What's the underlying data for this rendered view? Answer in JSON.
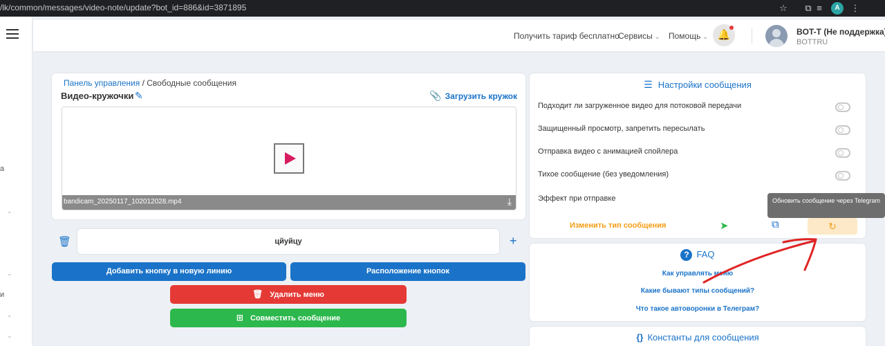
{
  "browser": {
    "url": "/lk/common/messages/video-note/update?bot_id=886&id=3871895",
    "profile_initial": "A"
  },
  "rail": {
    "fragments": [
      "а",
      "и"
    ]
  },
  "header": {
    "tariff_link": "Получить тариф бесплатно",
    "services": "Сервисы",
    "help": "Помощь",
    "user_name": "BOT-T (Не поддержка)",
    "user_login": "BOTTRU"
  },
  "breadcrumb": {
    "home": "Панель управления",
    "separator": " / ",
    "current": "Свободные сообщения"
  },
  "editor": {
    "title": "Видео-кружочки",
    "upload_label": "Загрузить кружок",
    "file_name": "bandicam_20250117_102012028.mp4",
    "button_text": "цйуйцу",
    "add_button_new_line": "Добавить кнопку в новую линию",
    "button_layout": "Расположение кнопок",
    "delete_menu": "Удалить меню",
    "combine_message": "Совместить сообщение"
  },
  "settings": {
    "title": "Настройки сообщения",
    "options": [
      {
        "label": "Подходит ли загруженное видео для потоковой передачи",
        "enabled": false
      },
      {
        "label": "Защищенный просмотр, запретить пересылать",
        "enabled": false
      },
      {
        "label": "Отправка видео с анимацией спойлера",
        "enabled": false
      },
      {
        "label": "Тихое сообщение (без уведомления)",
        "enabled": false
      }
    ],
    "effect_label": "Эффект при отправке",
    "change_type": "Изменить тип сообщения",
    "tooltip": "Обновить сообщение через Telegram"
  },
  "faq": {
    "title": "FAQ",
    "links": [
      "Как управлять меню",
      "Какие бывают типы сообщений?",
      "Что такое автоворонки в Телеграм?"
    ]
  },
  "constants": {
    "title": "Константы для сообщения"
  },
  "colors": {
    "primary": "#1a73c8",
    "danger": "#e53935",
    "success": "#2db84d",
    "warning": "#f39c12",
    "annotation": "#e02424"
  }
}
